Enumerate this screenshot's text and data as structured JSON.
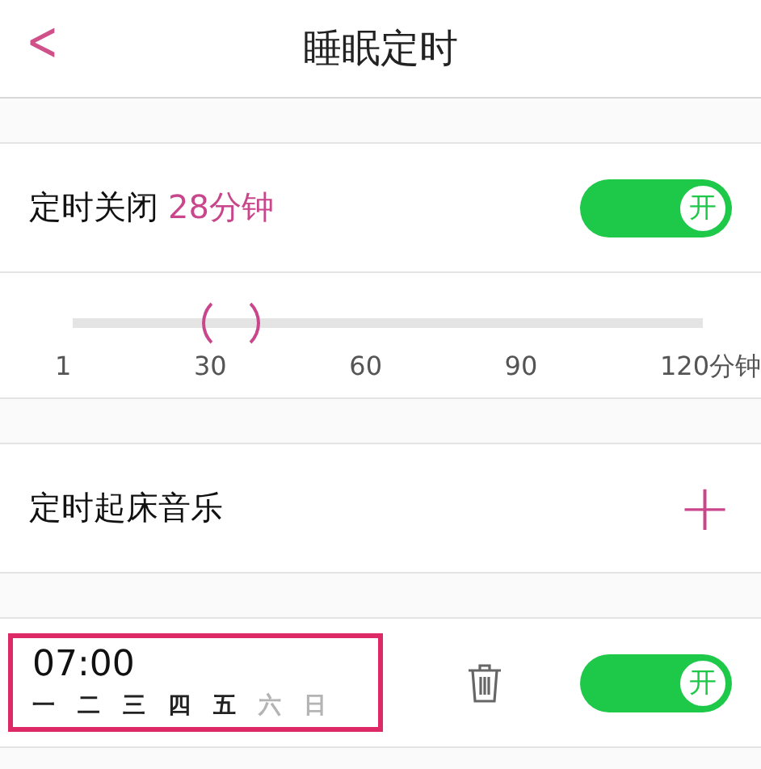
{
  "header": {
    "back": "<",
    "title": "睡眠定时"
  },
  "sleep_timer": {
    "label": "定时关闭",
    "value": "28分钟",
    "on": true,
    "switch_label": "开",
    "level": 0.25,
    "ticks": [
      "1",
      "30",
      "60",
      "90",
      "120分钟"
    ]
  },
  "wake_music": {
    "label": "定时起床音乐",
    "add": "+"
  },
  "alarms": [
    {
      "time": "07:00",
      "highlighted": true,
      "on": true,
      "switch_label": "开",
      "days": [
        {
          "label": "一",
          "on": true
        },
        {
          "label": "二",
          "on": true
        },
        {
          "label": "三",
          "on": true
        },
        {
          "label": "四",
          "on": true
        },
        {
          "label": "五",
          "on": true
        },
        {
          "label": "六",
          "on": false
        },
        {
          "label": "日",
          "on": false
        }
      ]
    }
  ]
}
